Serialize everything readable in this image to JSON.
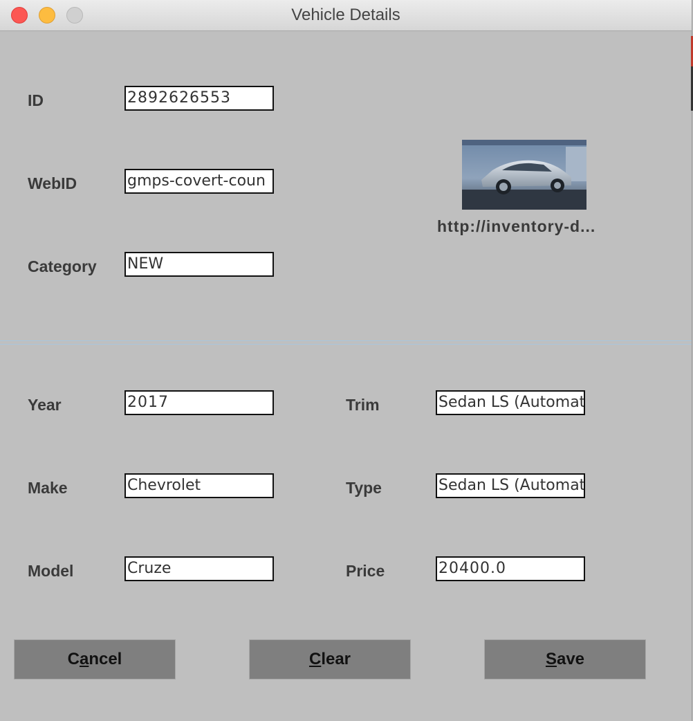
{
  "window": {
    "title": "Vehicle Details"
  },
  "fields": {
    "id": {
      "label": "ID",
      "value": "2892626553"
    },
    "webid": {
      "label": "WebID",
      "value": "gmps-covert-coun"
    },
    "category": {
      "label": "Category",
      "value": "NEW"
    },
    "year": {
      "label": "Year",
      "value": "2017"
    },
    "make": {
      "label": "Make",
      "value": "Chevrolet"
    },
    "model": {
      "label": "Model",
      "value": "Cruze"
    },
    "trim": {
      "label": "Trim",
      "value": "Sedan LS (Automat"
    },
    "type": {
      "label": "Type",
      "value": "Sedan LS (Automat"
    },
    "price": {
      "label": "Price",
      "value": "20400.0"
    }
  },
  "image": {
    "url_text": "http://inventory-d..."
  },
  "buttons": {
    "cancel": {
      "pre": "C",
      "mnemonic": "a",
      "post": "ncel"
    },
    "clear": {
      "pre": "",
      "mnemonic": "C",
      "post": "lear"
    },
    "save": {
      "pre": "",
      "mnemonic": "S",
      "post": "ave"
    }
  },
  "colors": {
    "background": "#bfbfbf",
    "button": "#7f7f7f"
  }
}
